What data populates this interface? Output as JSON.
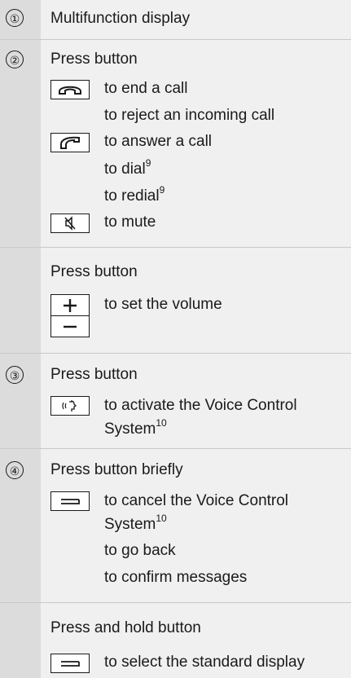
{
  "rows": [
    {
      "number": "①",
      "title": "Multifunction display"
    },
    {
      "number": "②",
      "title": "Press button",
      "items": [
        {
          "icon": "end-call-icon",
          "text": "to end a call"
        },
        {
          "text": "to reject an incoming call"
        },
        {
          "icon": "answer-call-icon",
          "text": "to answer a call"
        },
        {
          "text": "to dial",
          "sup": "9"
        },
        {
          "text": "to redial",
          "sup": "9"
        },
        {
          "icon": "mute-icon",
          "text": "to mute"
        }
      ]
    },
    {
      "title": "Press button",
      "items": [
        {
          "icon": "plus-icon",
          "text": "to set the volume"
        },
        {
          "icon": "minus-icon"
        }
      ]
    },
    {
      "number": "③",
      "title": "Press button",
      "items": [
        {
          "icon": "voice-control-icon",
          "text": "to activate the Voice Control",
          "text2": "System",
          "sup": "10"
        }
      ]
    },
    {
      "number": "④",
      "title": "Press button briefly",
      "items": [
        {
          "icon": "back-icon",
          "text": "to cancel the Voice Control",
          "text2": "System",
          "sup": "10"
        },
        {
          "text": "to go back"
        },
        {
          "text": "to confirm messages"
        }
      ]
    },
    {
      "title": "Press and hold button",
      "items": [
        {
          "icon": "back-icon",
          "text": "to select the standard display"
        }
      ]
    }
  ]
}
